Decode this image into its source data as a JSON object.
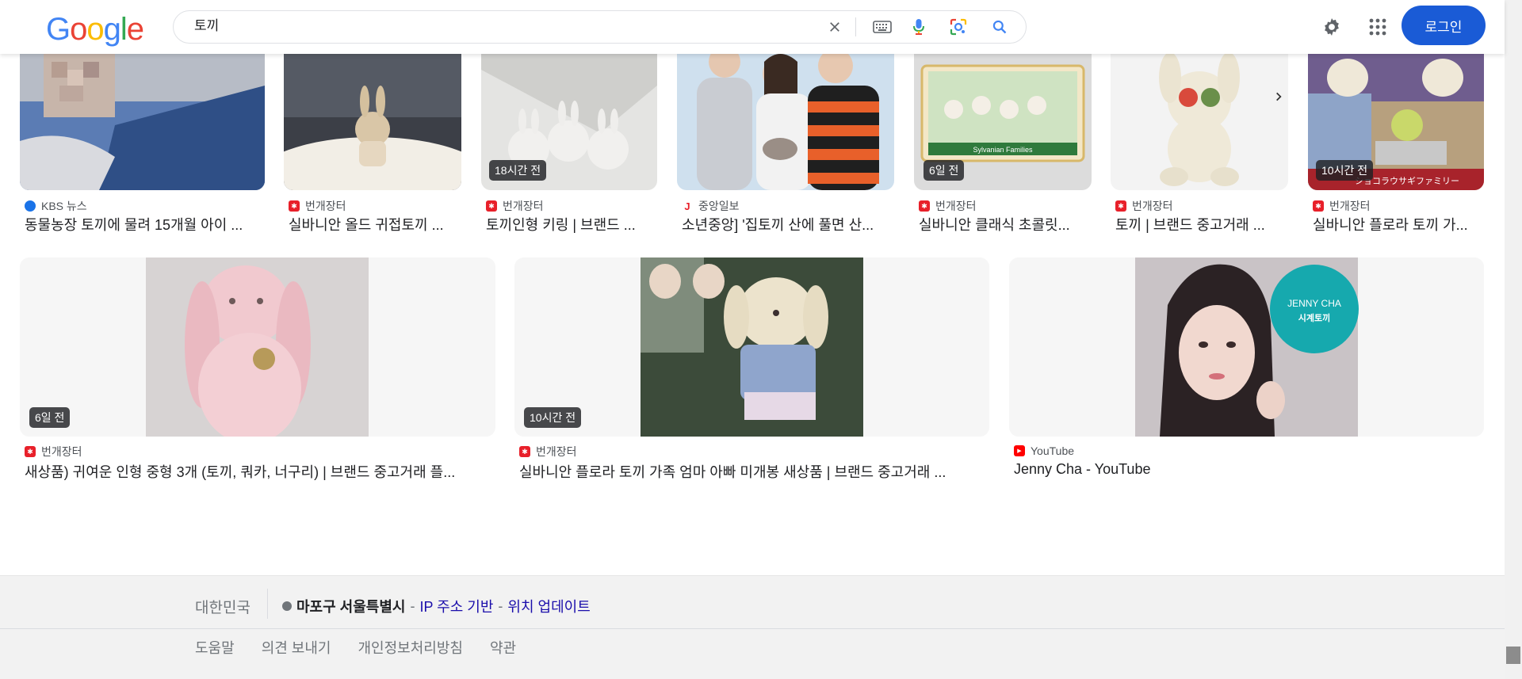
{
  "header": {
    "logo_letters": [
      "G",
      "o",
      "o",
      "g",
      "l",
      "e"
    ],
    "query": "토끼",
    "login_label": "로그인"
  },
  "row1": [
    {
      "source": "KBS 뉴스",
      "title": "동물농장 토끼에 물려 15개월 아이 ...",
      "badge": "",
      "source_color": "#1a73e8"
    },
    {
      "source": "번개장터",
      "title": "실바니안 올드 귀접토끼 ...",
      "badge": "",
      "source_color": "#e8202a"
    },
    {
      "source": "번개장터",
      "title": "토끼인형 키링 | 브랜드 ...",
      "badge": "18시간 전",
      "source_color": "#e8202a"
    },
    {
      "source": "중앙일보",
      "title": "소년중앙] '집토끼 산에 풀면 산...",
      "badge": "",
      "source_color": "#e8202a"
    },
    {
      "source": "번개장터",
      "title": "실바니안 클래식 초콜릿...",
      "badge": "6일 전",
      "source_color": "#e8202a"
    },
    {
      "source": "번개장터",
      "title": "토끼 | 브랜드 중고거래 ...",
      "badge": "",
      "source_color": "#e8202a"
    },
    {
      "source": "번개장터",
      "title": "실바니안 플로라 토끼 가...",
      "badge": "10시간 전",
      "source_color": "#e8202a"
    }
  ],
  "row1_image_text": {
    "sylvanian_box": "Sylvanian Families",
    "japanese_sign": "ショコラウサギファミリー"
  },
  "row2": [
    {
      "source": "번개장터",
      "title": "새상품) 귀여운 인형 중형 3개 (토끼, 쿼카, 너구리) | 브랜드 중고거래 플...",
      "badge": "6일 전",
      "source_color": "#e8202a"
    },
    {
      "source": "번개장터",
      "title": "실바니안 플로라 토끼 가족 엄마 아빠 미개봉 새상품 | 브랜드 중고거래 ...",
      "badge": "10시간 전",
      "source_color": "#e8202a"
    },
    {
      "source": "YouTube",
      "title": "Jenny Cha - YouTube",
      "badge": "",
      "source_color": "#ff0000"
    }
  ],
  "row2_image_text": {
    "logo_line1": "JENNY CHA",
    "logo_line2": "시계토끼"
  },
  "footer": {
    "country": "대한민국",
    "place": "마포구 서울특별시",
    "sep1": "-",
    "ip_based": "IP 주소 기반",
    "sep2": "-",
    "update_location": "위치 업데이트",
    "links": [
      "도움말",
      "의견 보내기",
      "개인정보처리방침",
      "약관"
    ]
  },
  "icons": [
    "clear-icon",
    "keyboard-icon",
    "mic-icon",
    "lens-icon",
    "search-icon",
    "settings-icon",
    "apps-icon",
    "chevron-right-icon"
  ]
}
